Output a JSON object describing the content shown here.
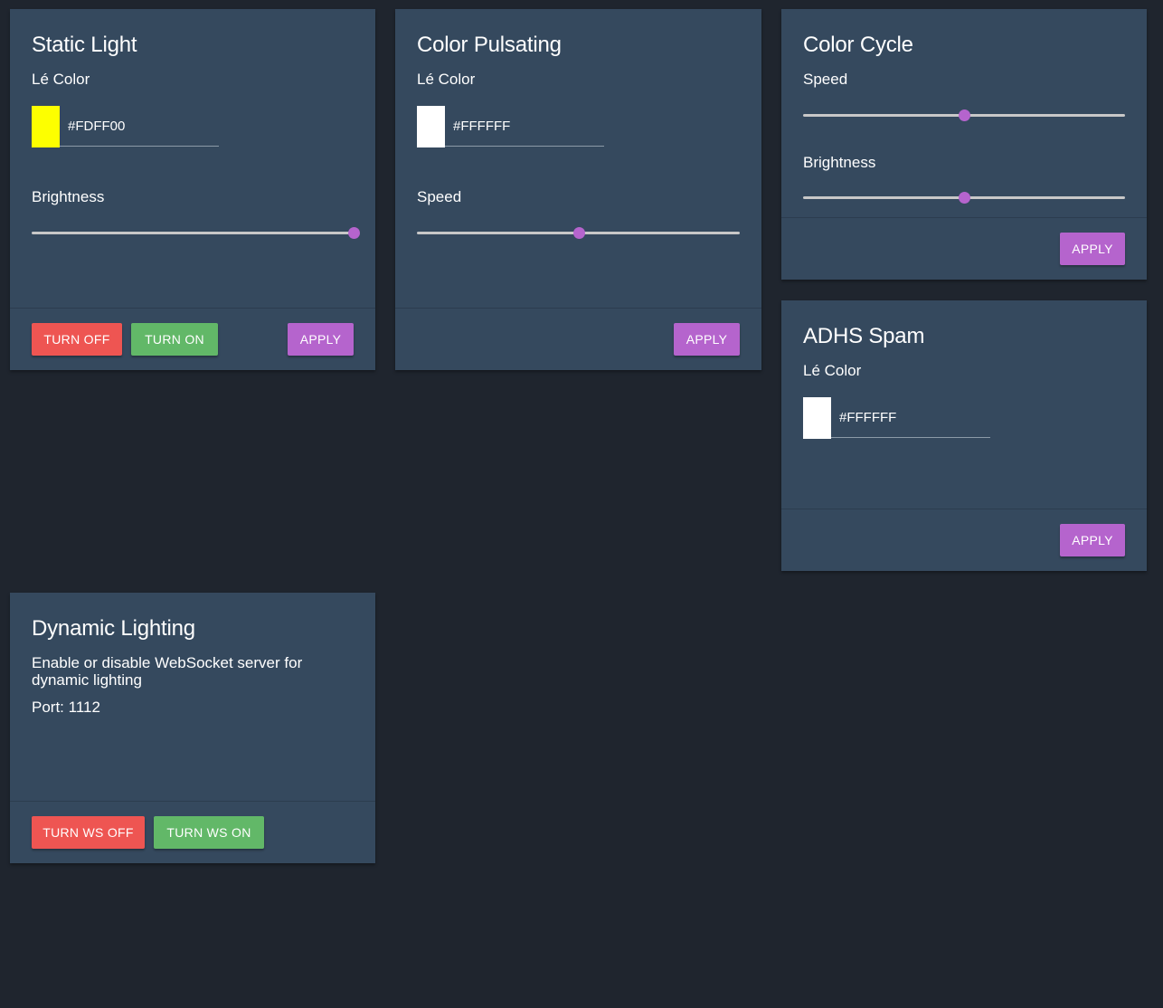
{
  "colors": {
    "background": "#1f252e",
    "card": "#35495e",
    "accent": "#b564cd",
    "danger": "#ee5552",
    "success": "#62b868"
  },
  "static_light": {
    "title": "Static Light",
    "color_label": "Lé Color",
    "color_value": "#FDFF00",
    "brightness_label": "Brightness",
    "brightness_value": 1.0,
    "turn_off_label": "TURN OFF",
    "turn_on_label": "TURN ON",
    "apply_label": "APPLY"
  },
  "color_pulsating": {
    "title": "Color Pulsating",
    "color_label": "Lé Color",
    "color_value": "#FFFFFF",
    "speed_label": "Speed",
    "speed_value": 0.5,
    "apply_label": "APPLY"
  },
  "color_cycle": {
    "title": "Color Cycle",
    "speed_label": "Speed",
    "speed_value": 0.5,
    "brightness_label": "Brightness",
    "brightness_value": 0.5,
    "apply_label": "APPLY"
  },
  "adhs_spam": {
    "title": "ADHS Spam",
    "color_label": "Lé Color",
    "color_value": "#FFFFFF",
    "apply_label": "APPLY"
  },
  "dynamic_lighting": {
    "title": "Dynamic Lighting",
    "description": "Enable or disable WebSocket server for dynamic lighting",
    "port_text": "Port: 1112",
    "turn_ws_off_label": "TURN WS OFF",
    "turn_ws_on_label": "TURN WS ON"
  }
}
